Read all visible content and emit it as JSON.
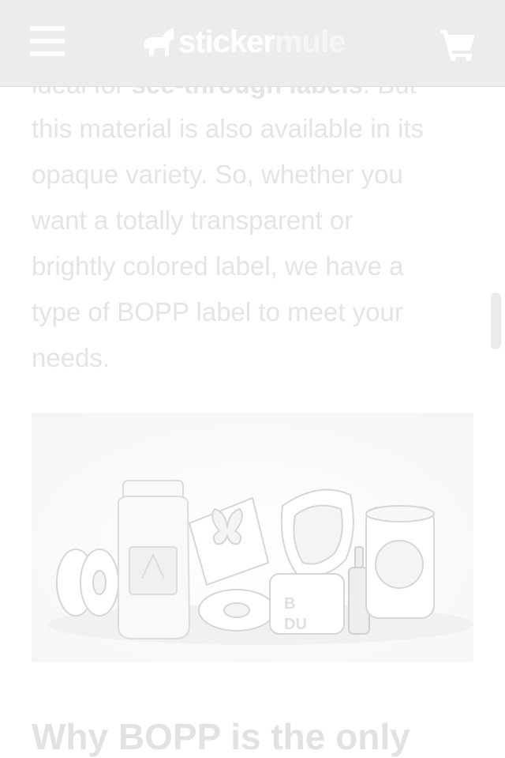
{
  "header": {
    "menu_icon": "hamburger-menu-icon",
    "logo": {
      "part1": "sticker",
      "part2": "mule",
      "icon": "mule-icon"
    },
    "cart_icon": "shopping-cart-icon"
  },
  "article": {
    "partial_line": {
      "prefix": "ideal for ",
      "bold": "see-through labels",
      "suffix": ". But"
    },
    "paragraph_lines": [
      "this material is also available in its",
      "opaque variety. So, whether you",
      "want a totally transparent or",
      "brightly colored label, we have a",
      "type of BOPP label to meet your",
      "needs."
    ],
    "next_heading": "Why BOPP is the only"
  },
  "colors": {
    "header_bg": "#ececec",
    "faded_text": "#e4e4e4",
    "icon_white": "#ffffff"
  }
}
